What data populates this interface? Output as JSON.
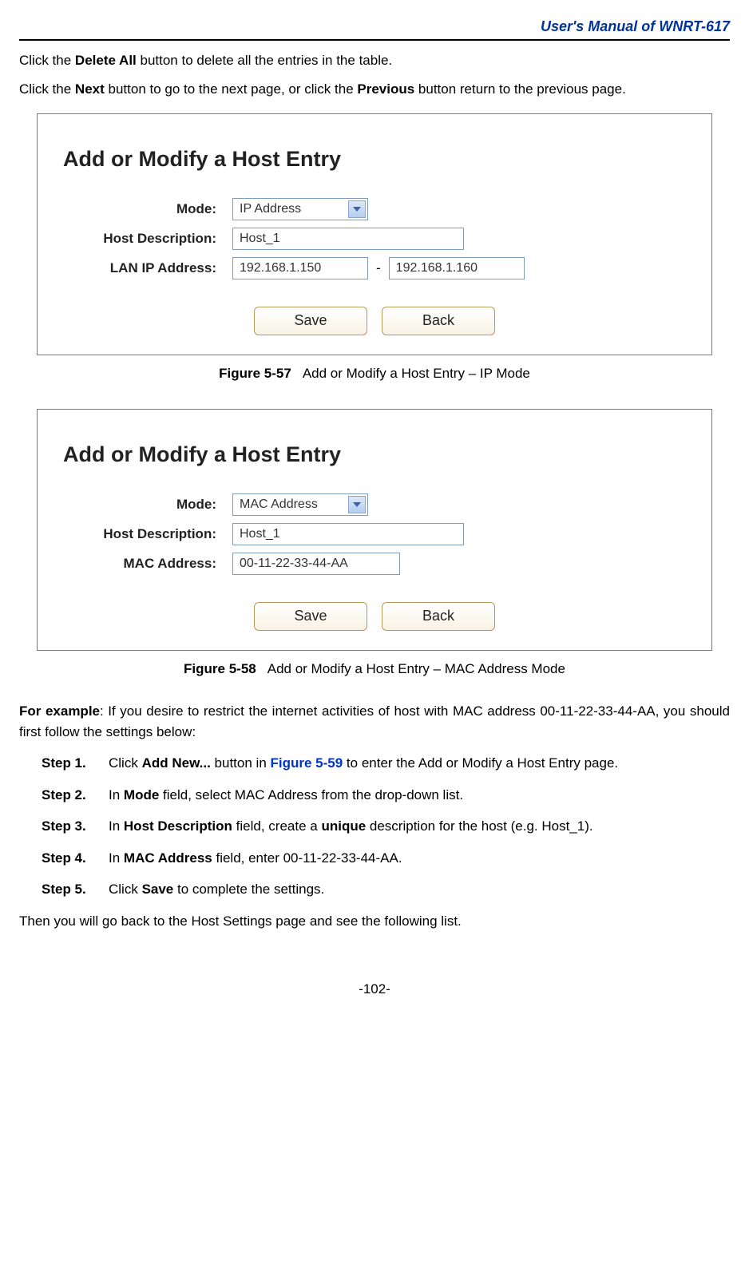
{
  "header": {
    "title": "User's  Manual  of  WNRT-617"
  },
  "intro": {
    "p1a": "Click the ",
    "p1b": "Delete All",
    "p1c": " button to delete all the entries in the table.",
    "p2a": "Click the ",
    "p2b": "Next",
    "p2c": " button to go to the next page, or click the ",
    "p2d": "Previous",
    "p2e": " button return to the previous page."
  },
  "figure1": {
    "title": "Add or Modify a Host Entry",
    "labels": {
      "mode": "Mode:",
      "desc": "Host Description:",
      "lan": "LAN IP Address:"
    },
    "values": {
      "mode": "IP Address",
      "desc": "Host_1",
      "ip_from": "192.168.1.150",
      "ip_to": "192.168.1.160"
    },
    "dash": "-",
    "buttons": {
      "save": "Save",
      "back": "Back"
    },
    "caption_num": "Figure 5-57",
    "caption_text": "Add or Modify a Host Entry – IP Mode"
  },
  "figure2": {
    "title": "Add or Modify a Host Entry",
    "labels": {
      "mode": "Mode:",
      "desc": "Host Description:",
      "mac": "MAC Address:"
    },
    "values": {
      "mode": "MAC Address",
      "desc": "Host_1",
      "mac": "00-11-22-33-44-AA"
    },
    "buttons": {
      "save": "Save",
      "back": "Back"
    },
    "caption_num": "Figure 5-58",
    "caption_text": "Add or Modify a Host Entry – MAC Address Mode"
  },
  "example": {
    "lead_bold": "For  example",
    "lead_rest": ":  If  you  desire  to  restrict  the  internet  activities  of  host  with  MAC  address 00-11-22-33-44-AA, you should first follow the settings below:",
    "steps": [
      {
        "label": "Step 1.",
        "pre": "Click ",
        "b1": "Add New...",
        "mid": " button in ",
        "link": "Figure 5-59",
        "post": " to enter the Add or Modify a Host Entry page."
      },
      {
        "label": "Step 2.",
        "pre": "In ",
        "b1": "Mode",
        "post": " field, select MAC Address from the drop-down list."
      },
      {
        "label": "Step 3.",
        "pre": "In ",
        "b1": "Host Description",
        "mid": " field, create a ",
        "b2": "unique",
        "post": " description for the host (e.g. Host_1)."
      },
      {
        "label": "Step 4.",
        "pre": "In ",
        "b1": "MAC Address",
        "post": " field, enter 00-11-22-33-44-AA."
      },
      {
        "label": "Step 5.",
        "pre": "Click ",
        "b1": "Save",
        "post": " to complete the settings."
      }
    ],
    "closing": "Then you will go back to the Host Settings page and see the following list."
  },
  "page_number": "-102-"
}
